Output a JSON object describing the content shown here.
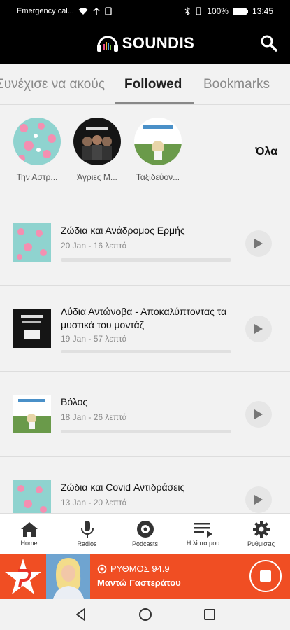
{
  "status_bar": {
    "carrier": "Emergency cal...",
    "battery": "100%",
    "time": "13:45"
  },
  "app": {
    "brand": "SOUNDIS"
  },
  "tabs": [
    {
      "label": "Συνέχισε να ακούς",
      "active": false
    },
    {
      "label": "Followed",
      "active": true
    },
    {
      "label": "Bookmarks",
      "active": false
    }
  ],
  "followed": {
    "items": [
      {
        "name": "Την Αστρ..."
      },
      {
        "name": "Άγριες Μ..."
      },
      {
        "name": "Ταξιδεύον..."
      }
    ],
    "all_label": "Όλα"
  },
  "episodes": [
    {
      "title": "Ζώδια και Ανάδρομος Ερμής",
      "meta": "20 Jan - 16 λεπτά",
      "progress": 0
    },
    {
      "title": "Λύδια Αντώνοβα - Αποκαλύπτοντας τα μυστικά του μοντάζ",
      "meta": "19 Jan - 57 λεπτά",
      "progress": 0
    },
    {
      "title": "Βόλος",
      "meta": "18 Jan - 26 λεπτά",
      "progress": 0
    },
    {
      "title": "Ζώδια και Covid Αντιδράσεις",
      "meta": "13 Jan - 20 λεπτά",
      "progress": 0
    }
  ],
  "bottom_nav": [
    {
      "label": "Home",
      "icon": "home-icon"
    },
    {
      "label": "Radios",
      "icon": "microphone-icon"
    },
    {
      "label": "Podcasts",
      "icon": "podcast-disc-icon"
    },
    {
      "label": "Η λίστα μου",
      "icon": "playlist-icon"
    },
    {
      "label": "Ρυθμίσεις",
      "icon": "gear-icon"
    }
  ],
  "player": {
    "station": "ΡΥΘΜΟΣ 94.9",
    "show": "Μαντώ Γαστεράτου"
  },
  "colors": {
    "accent": "#f04e23",
    "header": "#000000",
    "background": "#f2f2f2"
  }
}
